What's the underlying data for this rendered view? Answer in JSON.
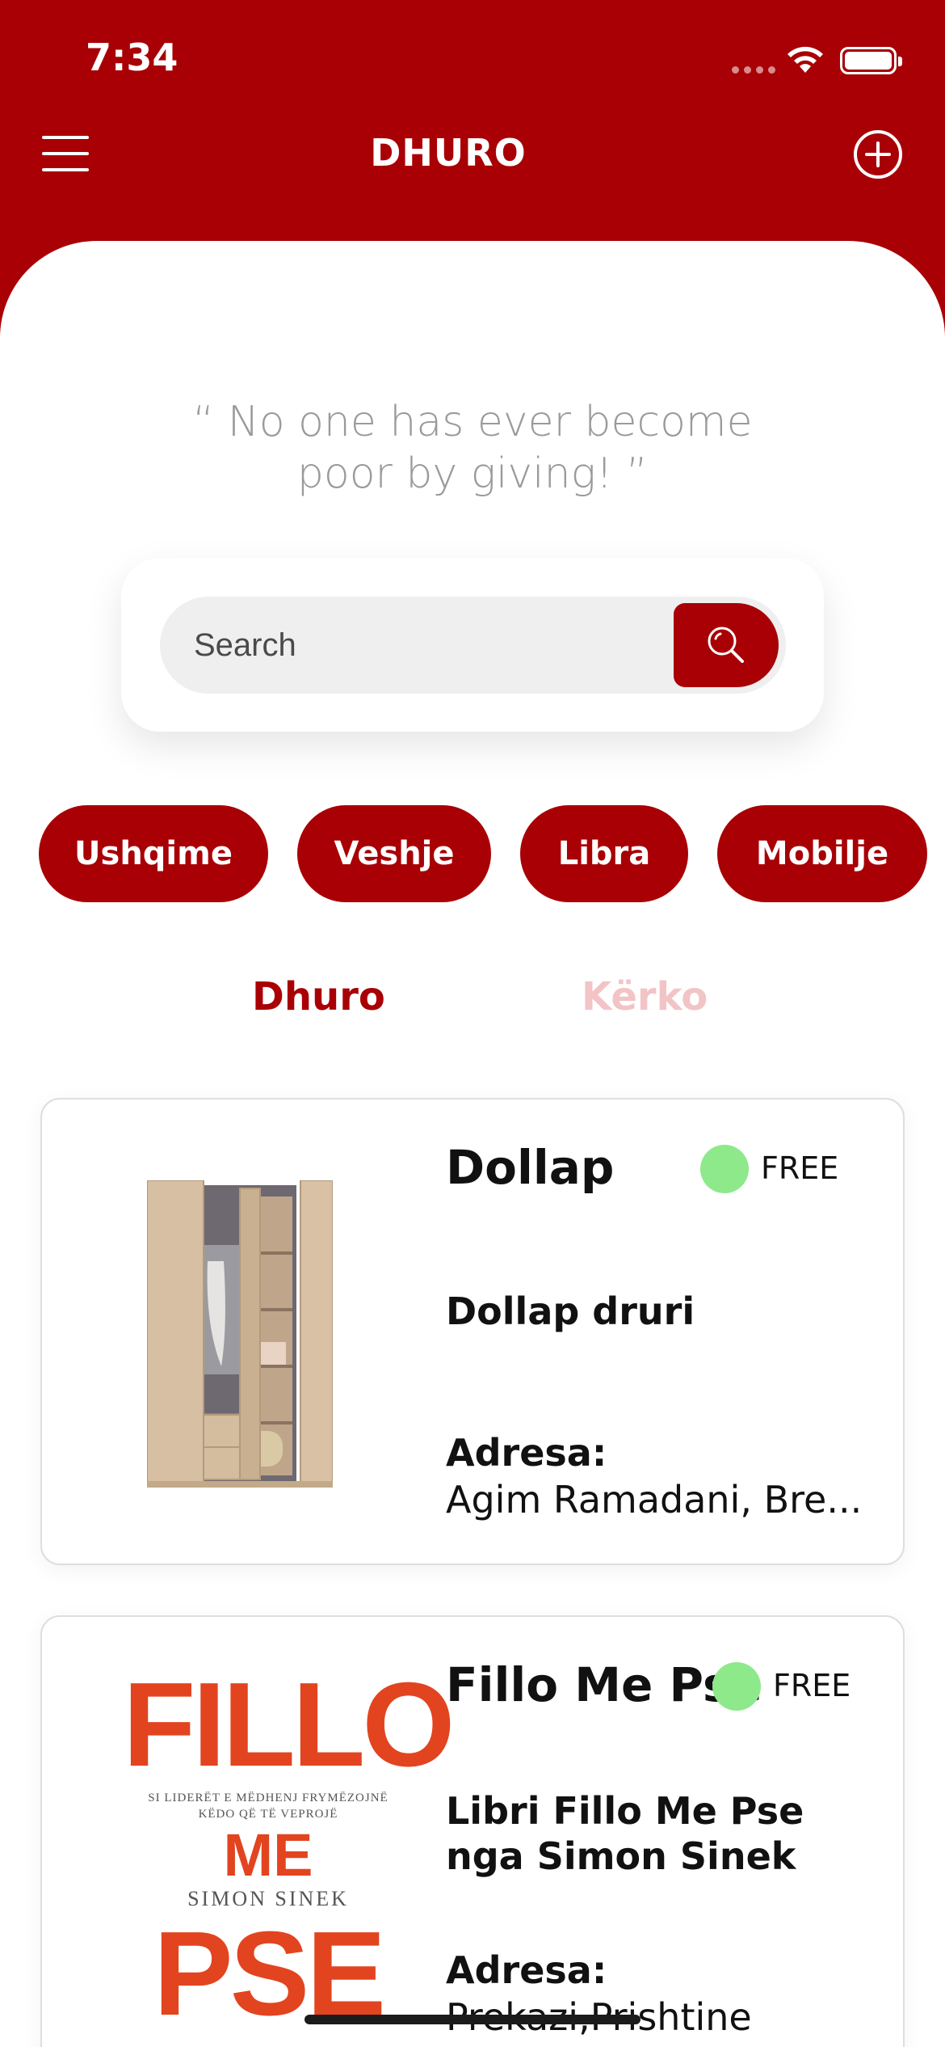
{
  "status_bar": {
    "time": "7:34"
  },
  "header": {
    "title": "DHURO",
    "menu_icon": "hamburger-menu-icon",
    "add_icon": "plus-circle-icon"
  },
  "quote": "“ No one has ever become poor by giving! ”",
  "search": {
    "placeholder": "Search",
    "value": "",
    "icon": "search-icon"
  },
  "categories": [
    "Ushqime",
    "Veshje",
    "Libra",
    "Mobilje"
  ],
  "tabs": [
    {
      "label": "Dhuro",
      "active": true
    },
    {
      "label": "Kërko",
      "active": false
    }
  ],
  "items": [
    {
      "title": "Dollap",
      "status": "FREE",
      "description": "Dollap druri",
      "address_label": "Adresa:",
      "address": "Agim Ramadani, Bre...",
      "image": "wardrobe-image"
    },
    {
      "title": "Fillo Me Pse",
      "status": "FREE",
      "description": "Libri Fillo Me Pse nga Simon Sinek",
      "address_label": "Adresa:",
      "address": "Prekazi,Prishtine",
      "image": "book-cover-image",
      "cover": {
        "line1": "FILLO",
        "subtitle": "SI LIDERËT E MËDHENJ FRYMËZOJNË KËDO QË TË VEPROJË",
        "line2": "ME",
        "author": "SIMON SINEK",
        "line3": "PSE"
      }
    }
  ],
  "colors": {
    "primary": "#a80005",
    "free_dot": "#8ee98a",
    "tab_inactive": "#f2c4c6"
  }
}
